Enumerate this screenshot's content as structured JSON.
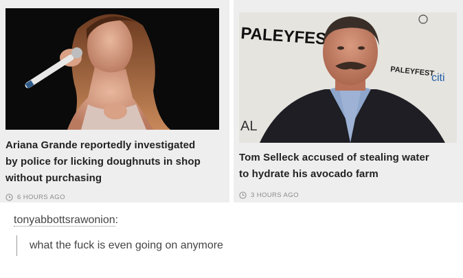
{
  "articles": [
    {
      "headline_lines": [
        "Ariana Grande reportedly investigated",
        "by police for licking doughnuts in shop",
        "without purchasing"
      ],
      "timestamp": "6 HOURS AGO",
      "photo_icon": "singer-with-microphone-photo"
    },
    {
      "headline_lines": [
        "Tom Selleck accused of stealing water",
        "to hydrate his avocado farm"
      ],
      "timestamp": "3 HOURS AGO",
      "photo_icon": "man-at-paleyfest-photo",
      "backdrop_text": {
        "main": "PALEYFEST",
        "small": "PALEYFEST",
        "sponsor": "citi",
        "partial": "AL"
      }
    }
  ],
  "post": {
    "username": "tonyabbottsrawonion",
    "username_suffix": ":",
    "comment": "what the fuck is even going on anymore"
  },
  "colors": {
    "card_bg": "#eeeeee",
    "headline": "#222222",
    "meta": "#8a8a8a",
    "text": "#444444"
  }
}
